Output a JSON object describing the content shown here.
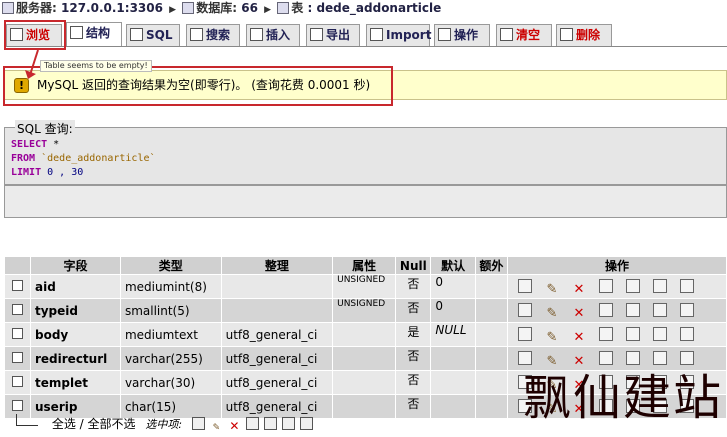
{
  "breadcrumb": {
    "server_label": "服务器:",
    "server": "127.0.0.1:3306",
    "db_label": "数据库:",
    "db": "66",
    "table_label": "表",
    "table": "dede_addonarticle"
  },
  "tabs": [
    {
      "label": "浏览",
      "icon": "browse-icon"
    },
    {
      "label": "结构",
      "icon": "structure-icon"
    },
    {
      "label": "SQL",
      "icon": "sql-icon"
    },
    {
      "label": "搜索",
      "icon": "search-icon"
    },
    {
      "label": "插入",
      "icon": "insert-icon"
    },
    {
      "label": "导出",
      "icon": "export-icon"
    },
    {
      "label": "Import",
      "icon": "import-icon"
    },
    {
      "label": "操作",
      "icon": "operations-icon"
    },
    {
      "label": "清空",
      "icon": "empty-icon"
    },
    {
      "label": "删除",
      "icon": "drop-icon"
    }
  ],
  "tooltip": "Table seems to be empty!",
  "notice": "MySQL 返回的查询结果为空(即零行)。 (查询花费  0.0001 秒)",
  "sql_box": {
    "legend": "SQL 查询:",
    "line1_kw": "SELECT",
    "line1_rest": " *",
    "line2_kw": "FROM",
    "line2_table": " `dede_addonarticle`",
    "line3_kw": "LIMIT",
    "line3_num": " 0 , 30"
  },
  "table": {
    "headers": [
      "",
      "字段",
      "类型",
      "整理",
      "属性",
      "Null",
      "默认",
      "额外",
      "操作"
    ],
    "rows": [
      {
        "field": "aid",
        "type": "mediumint(8)",
        "collation": "",
        "attr": "UNSIGNED",
        "null": "否",
        "default": "0",
        "extra": ""
      },
      {
        "field": "typeid",
        "type": "smallint(5)",
        "collation": "",
        "attr": "UNSIGNED",
        "null": "否",
        "default": "0",
        "extra": ""
      },
      {
        "field": "body",
        "type": "mediumtext",
        "collation": "utf8_general_ci",
        "attr": "",
        "null": "是",
        "default": "NULL",
        "extra": ""
      },
      {
        "field": "redirecturl",
        "type": "varchar(255)",
        "collation": "utf8_general_ci",
        "attr": "",
        "null": "否",
        "default": "",
        "extra": ""
      },
      {
        "field": "templet",
        "type": "varchar(30)",
        "collation": "utf8_general_ci",
        "attr": "",
        "null": "否",
        "default": "",
        "extra": ""
      },
      {
        "field": "userip",
        "type": "char(15)",
        "collation": "utf8_general_ci",
        "attr": "",
        "null": "否",
        "default": "",
        "extra": ""
      }
    ]
  },
  "footer": {
    "select_all": "全选",
    "sep": " / ",
    "deselect_all": "全部不选",
    "with_selected": "选中项:"
  },
  "watermark": "飘仙建站",
  "colors": {
    "highlight_box": "#c8282d",
    "notice_bg": "#ffffcc",
    "sql_keyword": "#990099"
  }
}
